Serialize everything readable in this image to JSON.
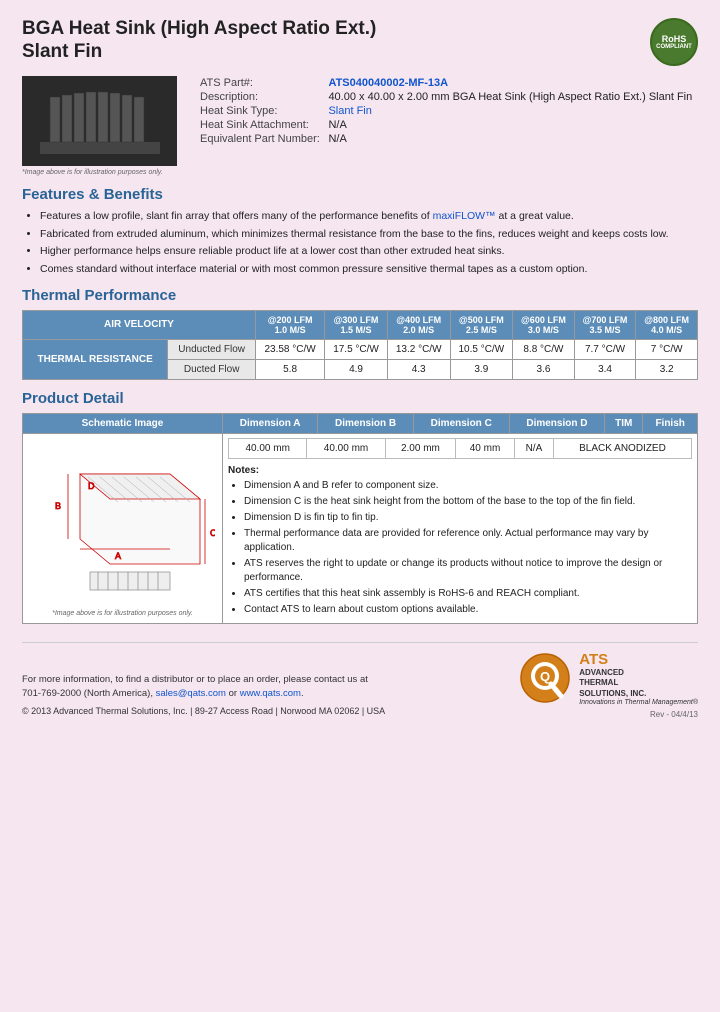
{
  "header": {
    "title_line1": "BGA Heat Sink (High Aspect Ratio Ext.)",
    "title_line2": "Slant Fin",
    "rohs": "RoHS\nCOMPLIANT"
  },
  "product_info": {
    "part_label": "ATS Part#:",
    "part_value": "ATS040040002-MF-13A",
    "desc_label": "Description:",
    "desc_value": "40.00 x 40.00 x 2.00 mm  BGA Heat Sink (High Aspect Ratio Ext.) Slant Fin",
    "type_label": "Heat Sink Type:",
    "type_value": "Slant Fin",
    "attach_label": "Heat Sink Attachment:",
    "attach_value": "N/A",
    "equiv_label": "Equivalent Part Number:",
    "equiv_value": "N/A"
  },
  "image_caption": "*Image above is for illustration purposes only.",
  "features_title": "Features & Benefits",
  "features": [
    "Features a low profile, slant fin array that offers many of the performance benefits of maxiFLOW™ at a great value.",
    "Fabricated from extruded aluminum, which minimizes thermal resistance from the base to the fins, reduces weight and keeps costs low.",
    "Higher performance helps ensure reliable product life at a lower cost than other extruded heat sinks.",
    "Comes standard without interface material or with most common pressure sensitive thermal tapes as a custom option."
  ],
  "thermal_title": "Thermal Performance",
  "thermal_table": {
    "col_headers": [
      {
        "lfm": "@200 LFM",
        "ms": "1.0 M/S"
      },
      {
        "lfm": "@300 LFM",
        "ms": "1.5 M/S"
      },
      {
        "lfm": "@400 LFM",
        "ms": "2.0 M/S"
      },
      {
        "lfm": "@500 LFM",
        "ms": "2.5 M/S"
      },
      {
        "lfm": "@600 LFM",
        "ms": "3.0 M/S"
      },
      {
        "lfm": "@700 LFM",
        "ms": "3.5 M/S"
      },
      {
        "lfm": "@800 LFM",
        "ms": "4.0 M/S"
      }
    ],
    "row_label": "THERMAL RESISTANCE",
    "rows": [
      {
        "label": "Unducted Flow",
        "values": [
          "23.58 °C/W",
          "17.5 °C/W",
          "13.2 °C/W",
          "10.5 °C/W",
          "8.8 °C/W",
          "7.7 °C/W",
          "7 °C/W"
        ]
      },
      {
        "label": "Ducted Flow",
        "values": [
          "5.8",
          "4.9",
          "4.3",
          "3.9",
          "3.6",
          "3.4",
          "3.2"
        ]
      }
    ]
  },
  "product_detail_title": "Product Detail",
  "product_detail": {
    "col_headers": [
      "Schematic Image",
      "Dimension A",
      "Dimension B",
      "Dimension C",
      "Dimension D",
      "TIM",
      "Finish"
    ],
    "dim_values": [
      "40.00 mm",
      "40.00 mm",
      "2.00 mm",
      "40 mm",
      "N/A",
      "BLACK ANODIZED"
    ],
    "schematic_caption": "*Image above is for illustration purposes only.",
    "notes_title": "Notes:",
    "notes": [
      "Dimension A and B refer to component size.",
      "Dimension C is the heat sink height from the bottom of the base to the top of the fin field.",
      "Dimension D is fin tip to fin tip.",
      "Thermal performance data are provided for reference only. Actual performance may vary by application.",
      "ATS reserves the right to update or change its products without notice to improve the design or performance.",
      "ATS certifies that this heat sink assembly is RoHS-6 and REACH compliant.",
      "Contact ATS to learn about custom options available."
    ]
  },
  "footer": {
    "contact_text": "For more information, to find a distributor or to place an order, please contact us at\n701-769-2000 (North America), sales@qats.com or www.qats.com.",
    "copyright": "© 2013 Advanced Thermal Solutions, Inc.  |  89-27 Access Road  |  Norwood MA  02062  |  USA",
    "ats_main": "ATS",
    "ats_full_line1": "ADVANCED",
    "ats_full_line2": "THERMAL",
    "ats_full_line3": "SOLUTIONS, INC.",
    "ats_tagline": "Innovations in Thermal Management®",
    "page_num": "Rev - 04/4/13"
  }
}
